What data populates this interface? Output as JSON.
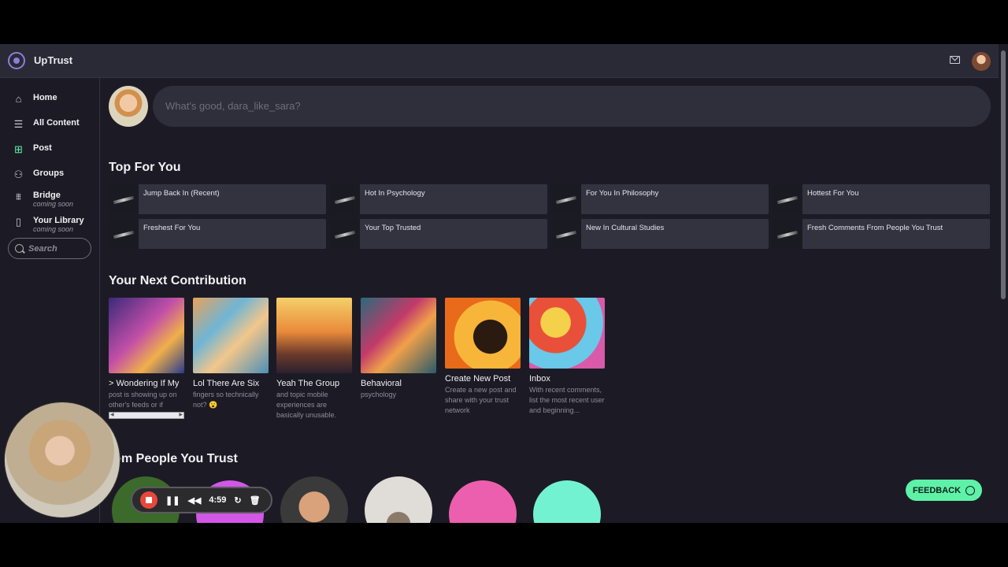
{
  "app": {
    "title": "UpTrust"
  },
  "header": {
    "mail_icon": "mail-icon",
    "avatar": "user-avatar"
  },
  "sidebar": {
    "items": [
      {
        "label": "Home",
        "icon": "home-icon",
        "sub": ""
      },
      {
        "label": "All Content",
        "icon": "list-icon",
        "sub": ""
      },
      {
        "label": "Post",
        "icon": "plus-square-icon",
        "sub": ""
      },
      {
        "label": "Groups",
        "icon": "groups-icon",
        "sub": ""
      },
      {
        "label": "Bridge",
        "icon": "bridge-icon",
        "sub": "coming soon"
      },
      {
        "label": "Your Library",
        "icon": "book-icon",
        "sub": "coming soon"
      }
    ],
    "search_label": "Search"
  },
  "composer": {
    "placeholder": "What's good, dara_like_sara?"
  },
  "top_for_you": {
    "title": "Top For You",
    "cards": [
      "Jump Back In (Recent)",
      "Hot In Psychology",
      "For You In Philosophy",
      "Hottest For You",
      "Freshest For You",
      "Your Top Trusted",
      "New In Cultural Studies",
      "Fresh Comments From People You Trust"
    ]
  },
  "next_contribution": {
    "title": "Your Next Contribution",
    "items": [
      {
        "title": "> Wondering If My",
        "desc": "post is showing up on other's feeds or if"
      },
      {
        "title": "Lol There Are Six",
        "desc": "fingers so technically not? 😮"
      },
      {
        "title": "Yeah The Group",
        "desc": "and topic mobile experiences are basically unusable."
      },
      {
        "title": "Behavioral",
        "desc": "psychology"
      },
      {
        "title": "Create New Post",
        "desc": "Create a new post and share with your trust network"
      },
      {
        "title": "Inbox",
        "desc": "With recent comments, list the most recent user and beginning..."
      }
    ]
  },
  "from_people": {
    "title": "rom People You Trust"
  },
  "feedback": {
    "label": "FEEDBACK"
  },
  "recorder": {
    "time": "4:59"
  },
  "colors": {
    "accent": "#5ef2a8",
    "brand": "#8b7fd6",
    "record": "#e8473c"
  }
}
